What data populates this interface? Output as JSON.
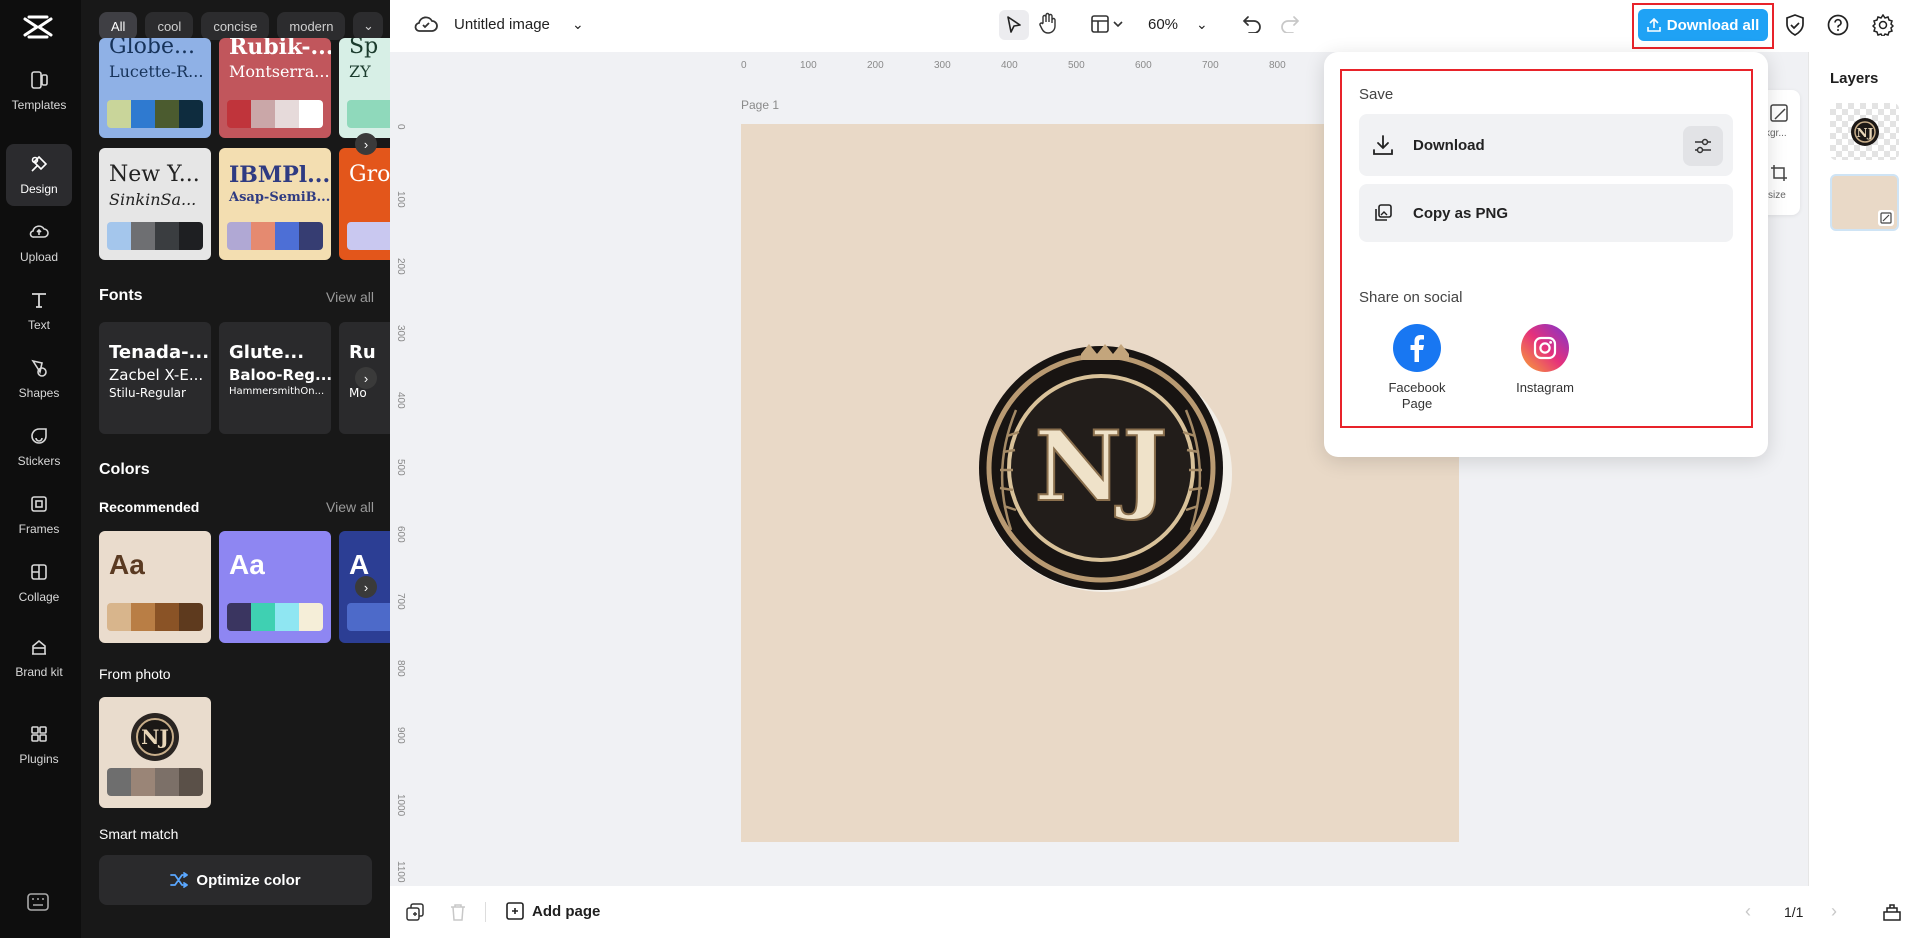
{
  "rail": {
    "items": [
      {
        "label": "Templates",
        "icon": "templates-icon"
      },
      {
        "label": "Design",
        "icon": "design-icon",
        "active": true
      },
      {
        "label": "Upload",
        "icon": "upload-icon"
      },
      {
        "label": "Text",
        "icon": "text-icon"
      },
      {
        "label": "Shapes",
        "icon": "shapes-icon"
      },
      {
        "label": "Stickers",
        "icon": "stickers-icon"
      },
      {
        "label": "Frames",
        "icon": "frames-icon"
      },
      {
        "label": "Collage",
        "icon": "collage-icon"
      },
      {
        "label": "Brand kit",
        "icon": "brand-kit-icon"
      },
      {
        "label": "Plugins",
        "icon": "plugins-icon"
      }
    ]
  },
  "panel": {
    "chips": [
      "All",
      "cool",
      "concise",
      "modern"
    ],
    "theme_cards": [
      {
        "title": "Globe...",
        "subtitle": "Lucette-R...",
        "colors": [
          "#c9d59a",
          "#2f7ad0",
          "#4b5b2f",
          "#0e2c3e"
        ],
        "bg": "#8fb1e6",
        "fg": "#17335a"
      },
      {
        "title": "Rubik-...",
        "subtitle": "Montserra...",
        "colors": [
          "#c0343b",
          "#caa7a8",
          "#e6dada",
          "#ffffff"
        ],
        "bg": "#c1565c",
        "fg": "#ffffff"
      },
      {
        "title": "Sp",
        "subtitle": "ZY",
        "colors": [
          "#8fd9bb",
          "#ffffff"
        ],
        "bg": "#d7efe6",
        "fg": "#1b3b2d"
      },
      {
        "title": "New Y...",
        "subtitle": "SinkinSa...",
        "colors": [
          "#a4c6ec",
          "#6e6f72",
          "#3a3d40",
          "#1e1f22"
        ],
        "bg": "#e6e6e6",
        "fg": "#222222"
      },
      {
        "title": "IBMPl...",
        "subtitle": "Asap-SemiB...",
        "colors": [
          "#b0a8d4",
          "#e58a70",
          "#4d6fd6",
          "#363d72"
        ],
        "bg": "#f3deb1",
        "fg": "#2f3b82"
      },
      {
        "title": "Gro",
        "subtitle": "",
        "colors": [
          "#c9c8f0"
        ],
        "bg": "#e3561b",
        "fg": "#ffffff"
      }
    ],
    "fonts_title": "Fonts",
    "fonts_view_all": "View all",
    "font_cards": [
      {
        "line1": "Tenada-...",
        "line2": "Zacbel X-E...",
        "line3": "Stilu-Regular"
      },
      {
        "line1": "Glute...",
        "line2": "Baloo-Reg...",
        "line3": "HammersmithOn..."
      },
      {
        "line1": "Ru",
        "line2": "",
        "line3": "Mo"
      }
    ],
    "colors_title": "Colors",
    "recommended_label": "Recommended",
    "recommended_view_all": "View all",
    "color_cards": [
      {
        "text": "Aa",
        "bg": "#eadccd",
        "fg": "#5a3a22",
        "colors": [
          "#d8b58c",
          "#b97e45",
          "#8a5326",
          "#5e3a1e"
        ]
      },
      {
        "text": "Aa",
        "bg": "#8e86f2",
        "fg": "#ffffff",
        "colors": [
          "#3a3560",
          "#3fd0b2",
          "#8fe6f2",
          "#f5eed8"
        ]
      },
      {
        "text": "A",
        "bg": "#2c3e94",
        "fg": "#ffffff",
        "colors": [
          "#4d6ac9"
        ]
      }
    ],
    "from_photo_label": "From photo",
    "photo_colors": [
      "#6e6e6e",
      "#9a8577",
      "#7c7068",
      "#5a5048"
    ],
    "smart_match_label": "Smart match",
    "optimize_label": "Optimize color"
  },
  "topbar": {
    "title": "Untitled image",
    "zoom": "60%",
    "download_all_label": "Download all"
  },
  "canvas": {
    "page_label": "Page 1",
    "ruler_h": [
      "0",
      "100",
      "200",
      "300",
      "400",
      "500",
      "600",
      "700",
      "800"
    ],
    "ruler_v": [
      "0",
      "100",
      "200",
      "300",
      "400",
      "500",
      "600",
      "700",
      "800",
      "900",
      "1000",
      "1100"
    ],
    "logo_letters": "NJ"
  },
  "bottombar": {
    "add_page_label": "Add page",
    "page_counter": "1/1"
  },
  "side_tools": {
    "bg_label": "kgr...",
    "resize_label": "size"
  },
  "layers": {
    "title": "Layers"
  },
  "popup": {
    "save_label": "Save",
    "download_label": "Download",
    "copy_png_label": "Copy as PNG",
    "share_label": "Share on social",
    "facebook_label": "Facebook Page",
    "instagram_label": "Instagram"
  }
}
